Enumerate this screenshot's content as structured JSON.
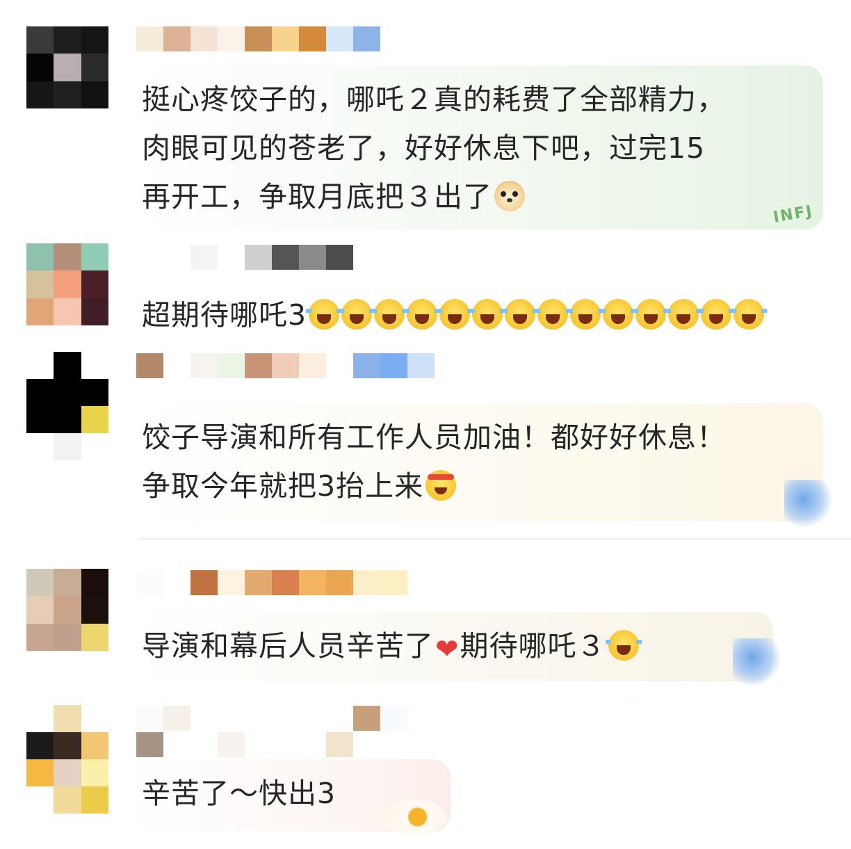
{
  "comments": [
    {
      "text": "挺心疼饺子的，哪吒２真的耗费了全部精力，\n肉眼可见的苍老了，好好休息下吧，过完15\n再开工，争取月底把３出了",
      "emoji": "doge-icon"
    },
    {
      "text": "超期待哪吒3",
      "emoji_count": 14
    },
    {
      "text": "饺子导演和所有工作人员加油！都好好休息！\n争取今年就把3抬上来",
      "emoji": "fighting-icon"
    },
    {
      "text": "导演和幕后人员辛苦了",
      "text_after": "期待哪吒３",
      "emoji": "laugh-icon"
    },
    {
      "text": "辛苦了～快出3"
    }
  ],
  "decor": {
    "badge_1": "INFJ"
  }
}
